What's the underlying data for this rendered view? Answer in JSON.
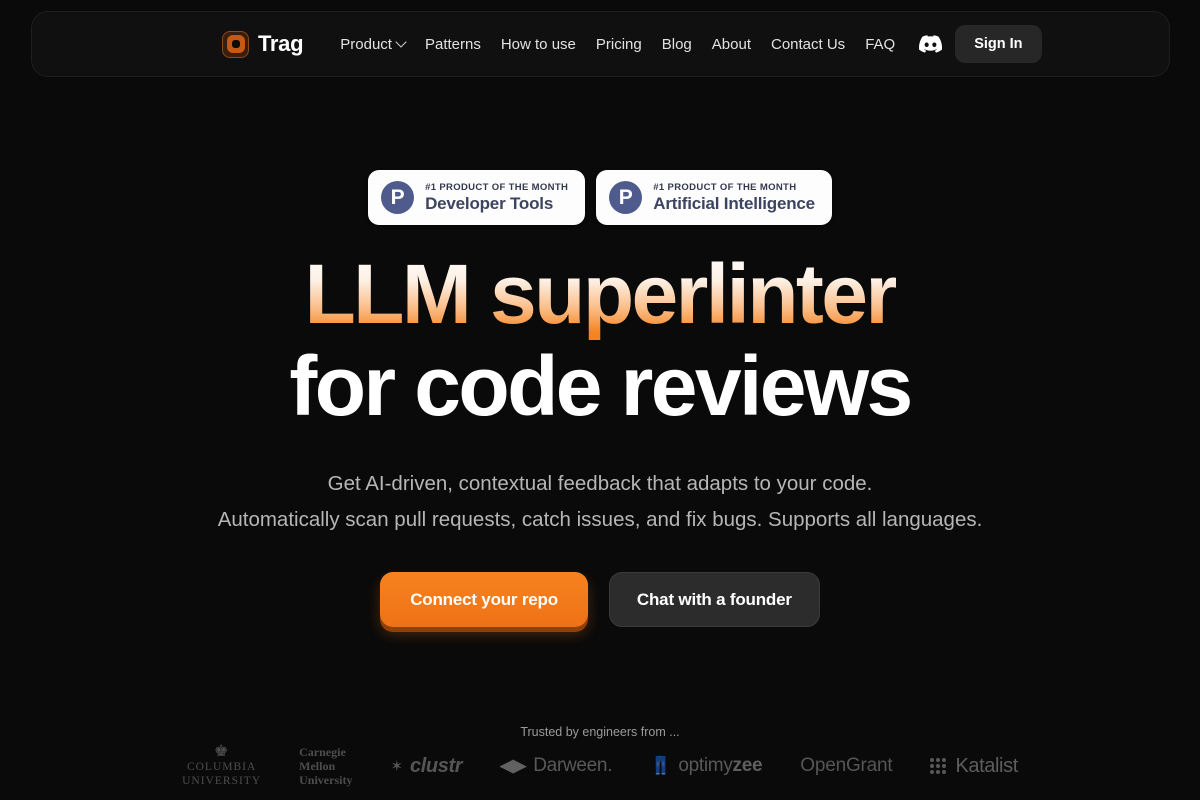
{
  "brand": {
    "name": "Trag",
    "logo_icon": "trag-square-logo-icon"
  },
  "nav": {
    "links": [
      {
        "label": "Product",
        "has_chevron": true
      },
      {
        "label": "Patterns",
        "has_chevron": false
      },
      {
        "label": "How to use",
        "has_chevron": false
      },
      {
        "label": "Pricing",
        "has_chevron": false
      },
      {
        "label": "Blog",
        "has_chevron": false
      },
      {
        "label": "About",
        "has_chevron": false
      },
      {
        "label": "Contact Us",
        "has_chevron": false
      },
      {
        "label": "FAQ",
        "has_chevron": false
      }
    ],
    "discord_icon": "discord-icon",
    "sign_in_label": "Sign In"
  },
  "badges": [
    {
      "icon": "product-hunt-icon",
      "glyph": "P",
      "kicker": "#1 PRODUCT OF THE MONTH",
      "title": "Developer Tools"
    },
    {
      "icon": "product-hunt-icon",
      "glyph": "P",
      "kicker": "#1 PRODUCT OF THE MONTH",
      "title": "Artificial Intelligence"
    }
  ],
  "hero": {
    "headline_line1": "LLM superlinter",
    "headline_line2": "for code reviews",
    "subtitle_line1": "Get AI-driven, contextual feedback that adapts to your code.",
    "subtitle_line2": "Automatically scan pull requests, catch issues, and fix bugs. Supports all languages."
  },
  "cta": {
    "primary_label": "Connect your repo",
    "secondary_label": "Chat with a founder"
  },
  "trust": {
    "label": "Trusted by engineers from ...",
    "logos": [
      {
        "name": "Columbia University",
        "line1": "COLUMBIA",
        "line2": "UNIVERSITY",
        "icon": "crown-icon"
      },
      {
        "name": "Carnegie Mellon University",
        "line1": "Carnegie",
        "line2": "Mellon",
        "line3": "University"
      },
      {
        "name": "clustr",
        "text": "clustr",
        "icon": "star-icon"
      },
      {
        "name": "Darween",
        "text": "Darween.",
        "icon": "darween-mark-icon"
      },
      {
        "name": "optimyzee",
        "text_light": "optimy",
        "text_bold": "zee",
        "icon": "optimyzee-mark-icon"
      },
      {
        "name": "OpenGrant",
        "text": "OpenGrant"
      },
      {
        "name": "Katalist",
        "text": "Katalist",
        "icon": "dot-grid-icon"
      }
    ]
  },
  "colors": {
    "page_background": "#0a0a0a",
    "nav_background": "#101010",
    "accent_orange": "#f2741c",
    "headline_gradient_top": "#ffffff",
    "headline_gradient_bottom": "#f5831f",
    "badge_background": "#fdfdfd",
    "badge_icon": "#4f5b8d",
    "secondary_button": "#2c2c2c"
  }
}
